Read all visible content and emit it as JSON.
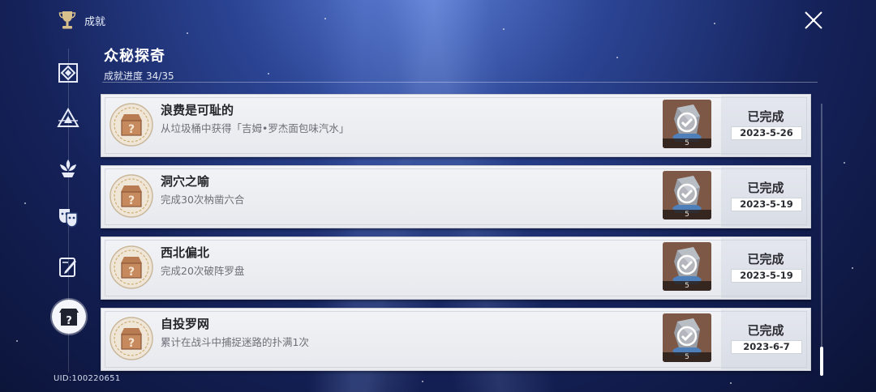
{
  "header": {
    "title": "成就",
    "close_icon": "close-icon"
  },
  "category": {
    "title": "众秘探奇",
    "progress_label": "成就进度",
    "progress_value": "34/35"
  },
  "sidebar": {
    "items": [
      {
        "icon": "diamond-frame-icon",
        "active": false
      },
      {
        "icon": "triangle-frame-icon",
        "active": false
      },
      {
        "icon": "lotus-emblem-icon",
        "active": false
      },
      {
        "icon": "masks-icon",
        "active": false
      },
      {
        "icon": "book-quill-icon",
        "active": false
      },
      {
        "icon": "mystery-box-icon",
        "active": true
      }
    ]
  },
  "uid": "UID:100220651",
  "achievements": [
    {
      "name": "浪费是可耻的",
      "desc": "从垃圾桶中获得「吉姆•罗杰面包味汽水」",
      "reward_qty": "5",
      "status": "已完成",
      "date": "2023-5-26"
    },
    {
      "name": "洞穴之喻",
      "desc": "完成30次枘凿六合",
      "reward_qty": "5",
      "status": "已完成",
      "date": "2023-5-19"
    },
    {
      "name": "西北偏北",
      "desc": "完成20次破阵罗盘",
      "reward_qty": "5",
      "status": "已完成",
      "date": "2023-5-19"
    },
    {
      "name": "自投罗网",
      "desc": "累计在战斗中捕捉迷路的扑满1次",
      "reward_qty": "5",
      "status": "已完成",
      "date": "2023-6-7"
    }
  ],
  "colors": {
    "accent_gold": "#c9a461",
    "card_bg": "#eceef2",
    "reward_bg": "#7d5846"
  }
}
